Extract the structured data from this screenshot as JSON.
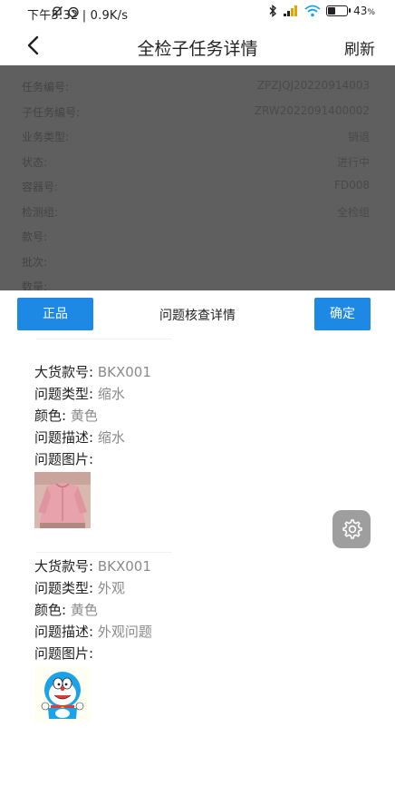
{
  "status_bar": {
    "left": "下午3:32 | 0.9K/s",
    "battery": "43",
    "battery_unit": "%",
    "battery_level": 0.43
  },
  "nav": {
    "title": "全检子任务详情",
    "refresh_label": "刷新"
  },
  "details": [
    {
      "label": "任务编号:",
      "value": "ZPZJQJ20220914003"
    },
    {
      "label": "子任务编号:",
      "value": "ZRW2022091400002"
    },
    {
      "label": "业务类型:",
      "value": "销退"
    },
    {
      "label": "状态:",
      "value": "进行中"
    },
    {
      "label": "容器号:",
      "value": "FD008"
    },
    {
      "label": "检测组:",
      "value": "全检组"
    },
    {
      "label": "款号:",
      "value": ""
    },
    {
      "label": "批次:",
      "value": ""
    },
    {
      "label": "数量:",
      "value": ""
    }
  ],
  "sheet": {
    "left_button": "正品",
    "title": "问题核查详情",
    "confirm_button": "确定"
  },
  "issues": [
    {
      "style_label": "大货款号:",
      "style_value": "BKX001",
      "type_label": "问题类型:",
      "type_value": "缩水",
      "color_label": "颜色:",
      "color_value": "黄色",
      "desc_label": "问题描述:",
      "desc_value": "缩水",
      "image_label": "问题图片:"
    },
    {
      "style_label": "大货款号:",
      "style_value": "BKX001",
      "type_label": "问题类型:",
      "type_value": "外观",
      "color_label": "颜色:",
      "color_value": "黄色",
      "desc_label": "问题描述:",
      "desc_value": "外观问题",
      "image_label": "问题图片:"
    }
  ],
  "colors": {
    "primary": "#1e88e5",
    "overlay": "#5f5f5f",
    "value_gray": "#8a8a8a"
  }
}
